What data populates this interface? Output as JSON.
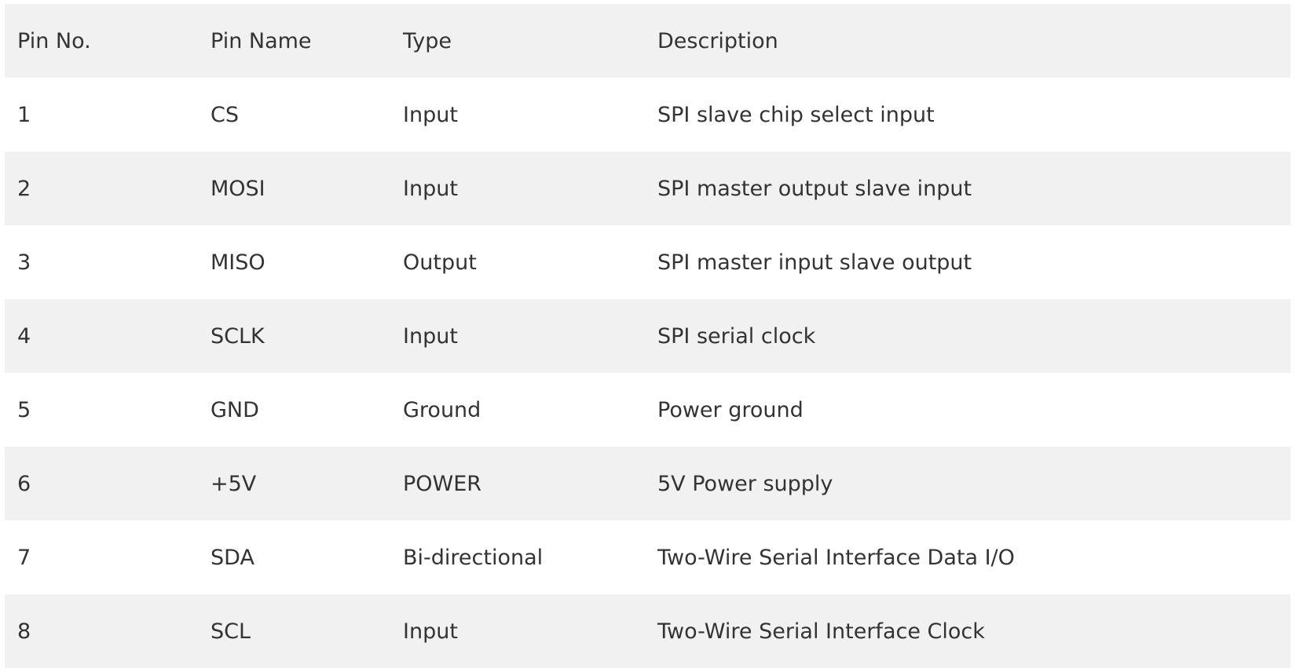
{
  "table": {
    "headers": {
      "pin_no": "Pin No.",
      "pin_name": "Pin Name",
      "type": "Type",
      "description": "Description"
    },
    "rows": [
      {
        "pin_no": "1",
        "pin_name": "CS",
        "type": "Input",
        "description": "SPI slave chip select input"
      },
      {
        "pin_no": "2",
        "pin_name": "MOSI",
        "type": "Input",
        "description": "SPI master output slave input"
      },
      {
        "pin_no": "3",
        "pin_name": "MISO",
        "type": "Output",
        "description": "SPI master input slave output"
      },
      {
        "pin_no": "4",
        "pin_name": "SCLK",
        "type": "Input",
        "description": "SPI serial clock"
      },
      {
        "pin_no": "5",
        "pin_name": "GND",
        "type": "Ground",
        "description": "Power ground"
      },
      {
        "pin_no": "6",
        "pin_name": "+5V",
        "type": "POWER",
        "description": "5V Power supply"
      },
      {
        "pin_no": "7",
        "pin_name": "SDA",
        "type": "Bi-directional",
        "description": "Two-Wire Serial Interface Data I/O"
      },
      {
        "pin_no": "8",
        "pin_name": "SCL",
        "type": "Input",
        "description": "Two-Wire Serial Interface Clock"
      }
    ]
  },
  "colors": {
    "stripe": "#f1f1f1",
    "background": "#ffffff",
    "text": "#333333"
  }
}
